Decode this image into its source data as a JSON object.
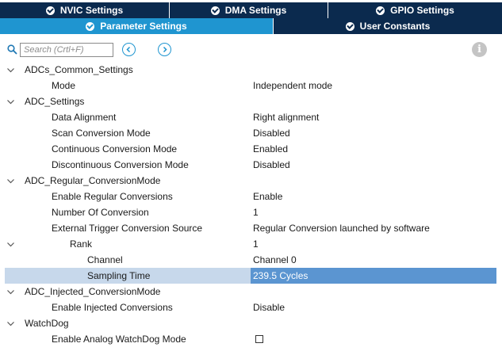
{
  "tabs_row1": [
    {
      "label": "NVIC Settings"
    },
    {
      "label": "DMA Settings"
    },
    {
      "label": "GPIO Settings"
    }
  ],
  "tabs_row2": [
    {
      "label": "Parameter Settings",
      "active": true
    },
    {
      "label": "User Constants"
    }
  ],
  "search": {
    "placeholder": "Search (Crtl+F)"
  },
  "tree": {
    "g1": {
      "label": "ADCs_Common_Settings",
      "mode_label": "Mode",
      "mode_value": "Independent mode"
    },
    "g2": {
      "label": "ADC_Settings",
      "data_alignment_label": "Data Alignment",
      "data_alignment_value": "Right alignment",
      "scan_label": "Scan Conversion Mode",
      "scan_value": "Disabled",
      "continuous_label": "Continuous Conversion Mode",
      "continuous_value": "Enabled",
      "discontinuous_label": "Discontinuous Conversion Mode",
      "discontinuous_value": "Disabled"
    },
    "g3": {
      "label": "ADC_Regular_ConversionMode",
      "enable_regular_label": "Enable Regular Conversions",
      "enable_regular_value": "Enable",
      "num_conv_label": "Number Of Conversion",
      "num_conv_value": "1",
      "ext_trigger_label": "External Trigger Conversion Source",
      "ext_trigger_value": "Regular Conversion launched by software",
      "rank_label": "Rank",
      "rank_value": "1",
      "channel_label": "Channel",
      "channel_value": "Channel 0",
      "sampling_label": "Sampling Time",
      "sampling_value": "239.5 Cycles"
    },
    "g4": {
      "label": "ADC_Injected_ConversionMode",
      "enable_injected_label": "Enable Injected Conversions",
      "enable_injected_value": "Disable"
    },
    "g5": {
      "label": "WatchDog",
      "analog_wd_label": "Enable Analog WatchDog Mode",
      "analog_wd_checked": false
    }
  },
  "colors": {
    "tab_dark": "#0b2a4e",
    "tab_active": "#1f95d0",
    "selection": "#5b95d1"
  }
}
